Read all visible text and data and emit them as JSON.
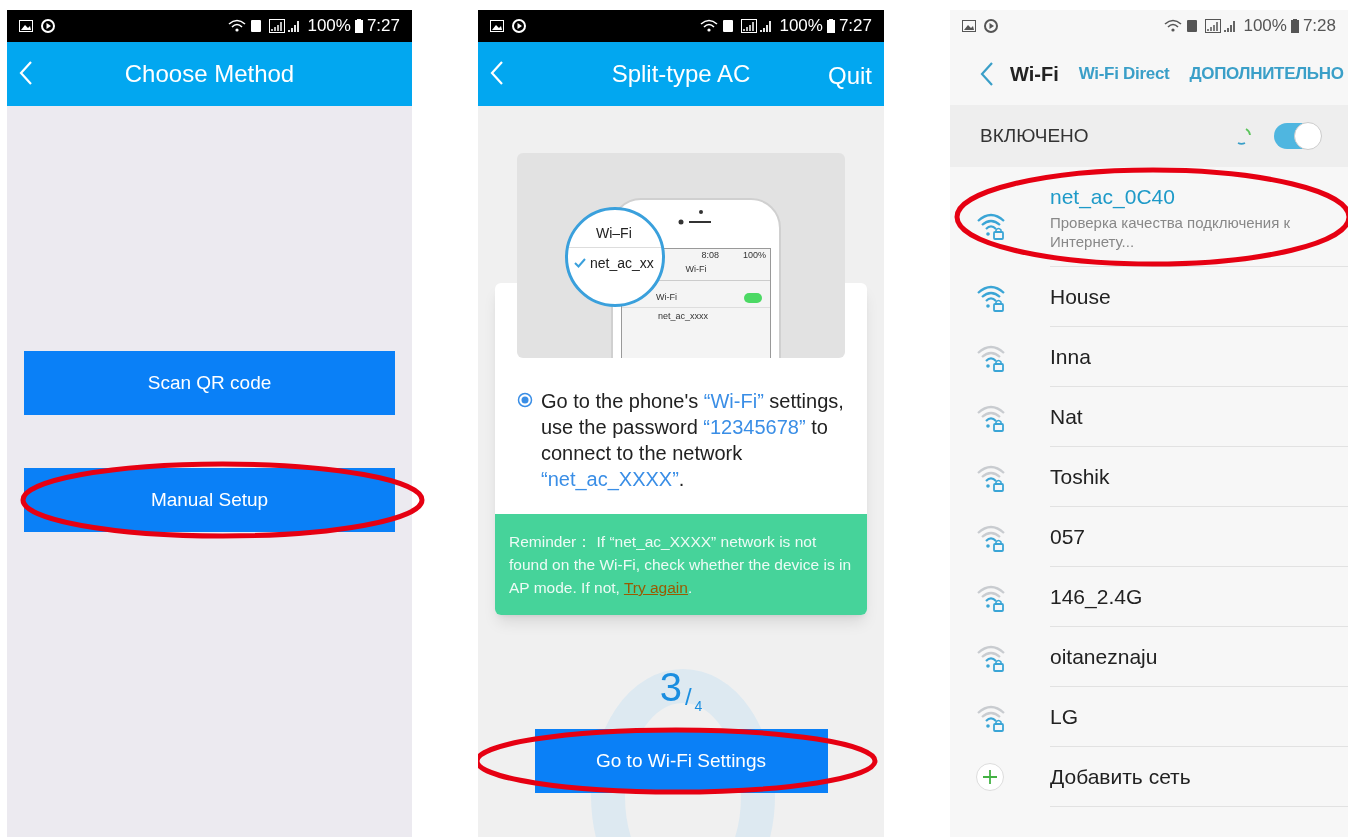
{
  "phones": [
    {
      "kind": "method",
      "status_bar": {
        "battery": "100%",
        "time": "7:27"
      },
      "header": {
        "title": "Choose Method"
      },
      "buttons": [
        {
          "label": "Scan QR code",
          "circled": false
        },
        {
          "label": "Manual Setup",
          "circled": true
        }
      ]
    },
    {
      "kind": "step",
      "status_bar": {
        "battery": "100%",
        "time": "7:27"
      },
      "header": {
        "title": "Split-type AC",
        "action": "Quit"
      },
      "illustration": {
        "magnifier_title": "Wi–Fi",
        "magnifier_item": "net_ac_xx",
        "phone_time": "8:08",
        "phone_battery": "100%",
        "phone_title": "Wi-Fi",
        "phone_toggle_label": "Wi-Fi",
        "phone_toggle_on": true,
        "phone_network": "net_ac_xxxx"
      },
      "instruction": [
        {
          "text": "Go to the phone's ",
          "highlight": false
        },
        {
          "text": "“Wi-Fi”",
          "highlight": true
        },
        {
          "text": " settings, use the password ",
          "highlight": false
        },
        {
          "text": "“12345678”",
          "highlight": true
        },
        {
          "text": " to connect to the network ",
          "highlight": false
        },
        {
          "text": "“net_ac_XXXX”",
          "highlight": true
        },
        {
          "text": ".",
          "highlight": false
        }
      ],
      "reminder": {
        "text": "Reminder： If “net_ac_XXXX” network is not found on the Wi-Fi, check whether the device is in AP mode. If not, ",
        "link": "Try again",
        "end": "."
      },
      "step": {
        "current": "3",
        "separator": "/",
        "total": "4"
      },
      "button": {
        "label": "Go to Wi-Fi Settings",
        "circled": true
      }
    },
    {
      "kind": "wifi",
      "status_bar": {
        "battery": "100%",
        "time": "7:28"
      },
      "nav": {
        "title": "Wi-Fi",
        "tabs": [
          "Wi-Fi Direct",
          "ДОПОЛНИТЕЛЬНО"
        ]
      },
      "switch": {
        "label": "ВКЛЮЧЕНО",
        "on": true
      },
      "networks": [
        {
          "kind": "network",
          "name": "net_ac_0C40",
          "status": "Проверка качества подключения к Интернету...",
          "active": true,
          "circled": true
        },
        {
          "kind": "network",
          "name": "House",
          "active": false,
          "circled": false
        },
        {
          "kind": "network",
          "name": "Inna",
          "active": false,
          "circled": false
        },
        {
          "kind": "network",
          "name": "Nat",
          "active": false,
          "circled": false
        },
        {
          "kind": "network",
          "name": "Toshik",
          "active": false,
          "circled": false
        },
        {
          "kind": "network",
          "name": "057",
          "active": false,
          "circled": false
        },
        {
          "kind": "network",
          "name": "146_2.4G",
          "active": false,
          "circled": false
        },
        {
          "kind": "network",
          "name": "oitaneznaju",
          "active": false,
          "circled": false
        },
        {
          "kind": "network",
          "name": "LG",
          "active": false,
          "circled": false
        },
        {
          "kind": "add",
          "name": "Добавить сеть"
        }
      ]
    }
  ]
}
